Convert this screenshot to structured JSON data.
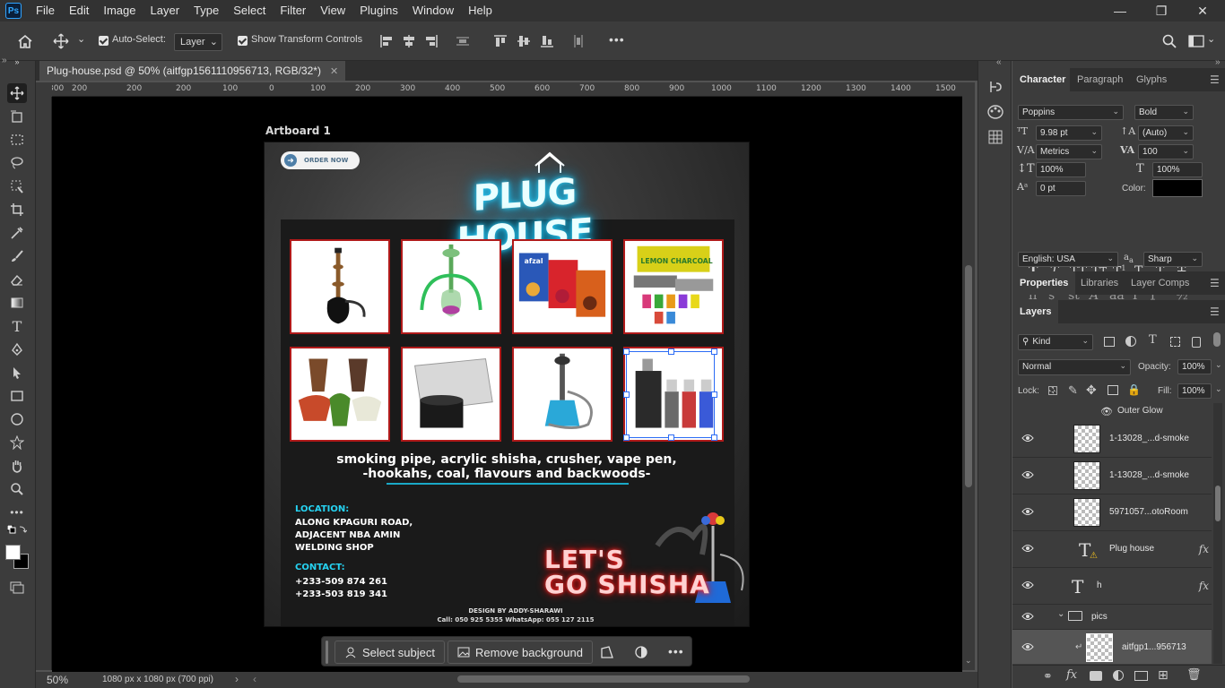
{
  "app": {
    "logo": "Ps"
  },
  "menu": [
    "File",
    "Edit",
    "Image",
    "Layer",
    "Type",
    "Select",
    "Filter",
    "View",
    "Plugins",
    "Window",
    "Help"
  ],
  "options": {
    "auto_select_label": "Auto-Select:",
    "auto_select_value": "Layer",
    "transform_controls_label": "Show Transform Controls",
    "more": "•••"
  },
  "document": {
    "tab_title": "Plug-house.psd @ 50% (aitfgp1561110956713, RGB/32*)",
    "artboard_label": "Artboard 1",
    "ruler_ticks": [
      "300",
      "200",
      "100",
      "0",
      "100",
      "200",
      "300",
      "400",
      "500",
      "600",
      "700",
      "800",
      "900",
      "1000",
      "1100",
      "1200",
      "1300",
      "1400",
      "1500"
    ],
    "zoom": "50%",
    "doc_info": "1080 px x 1080 px (700 ppi)"
  },
  "design": {
    "order_now": "ORDER NOW",
    "brand": "PLUG HOUSE",
    "tagline_1": "smoking pipe, acrylic shisha, crusher, vape pen,",
    "tagline_2": "-hookahs, coal, flavours and backwoods-",
    "location_head": "LOCATION:",
    "location_lines": [
      "ALONG KPAGURI ROAD,",
      "ADJACENT NBA AMIN",
      "WELDING SHOP"
    ],
    "contact_head": "CONTACT:",
    "contact_lines": [
      "+233-509 874 261",
      "+233-503 819 341"
    ],
    "slogan_1": "LET'S",
    "slogan_2": "GO SHISHA",
    "credit_1": "DESIGN BY ADDY-SHARAWI",
    "credit_2": "Call: 050 925 5355  WhatsApp: 055 127 2115",
    "product_box_lemon": "LEMON CHARCOAL",
    "product_box_afzal": "afzal"
  },
  "taskbar": {
    "select_subject": "Select subject",
    "remove_background": "Remove background",
    "more": "•••"
  },
  "character": {
    "tabs": [
      "Character",
      "Paragraph",
      "Glyphs"
    ],
    "font_family": "Poppins",
    "font_style": "Bold",
    "font_size": "9.98 pt",
    "leading": "(Auto)",
    "kerning": "Metrics",
    "tracking": "100",
    "vertical_scale": "100%",
    "horizontal_scale": "100%",
    "baseline_shift": "0 pt",
    "color_label": "Color:",
    "color_value": "#000000",
    "language": "English: USA",
    "antialias": "Sharp"
  },
  "properties_tabs": [
    "Properties",
    "Libraries",
    "Layer Comps"
  ],
  "layers": {
    "title": "Layers",
    "filter_kind": "Kind",
    "blend_mode": "Normal",
    "opacity_label": "Opacity:",
    "opacity": "100%",
    "lock_label": "Lock:",
    "fill_label": "Fill:",
    "fill": "100%",
    "effect_row": "Outer Glow",
    "rows": [
      {
        "name": "1-13028_...d-smoke",
        "type": "smart"
      },
      {
        "name": "1-13028_...d-smoke",
        "type": "smart"
      },
      {
        "name": "5971057...otoRoom",
        "type": "smart"
      },
      {
        "name": "Plug house",
        "type": "text",
        "fx": "fx"
      },
      {
        "name": "h",
        "type": "text",
        "fx": "fx"
      },
      {
        "name": "pics",
        "type": "group"
      },
      {
        "name": "aitfgp1...956713",
        "type": "smart"
      }
    ]
  }
}
